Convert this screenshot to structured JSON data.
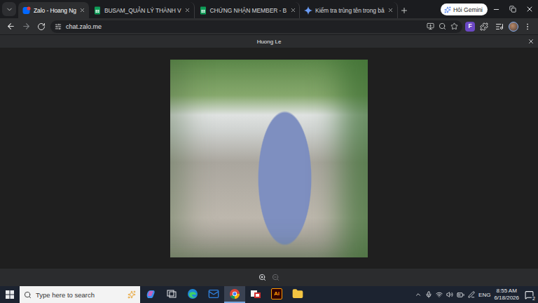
{
  "browser": {
    "tabs": [
      {
        "label": "Zalo - Hoang Ng",
        "selected": true,
        "kind": "zalo"
      },
      {
        "label": "BUSAM_QUẢN LÝ THÀNH V",
        "selected": false,
        "kind": "sheets"
      },
      {
        "label": "CHỨNG NHẬN MEMBER - B",
        "selected": false,
        "kind": "sheets"
      },
      {
        "label": "Kiểm tra trùng tên trong bả",
        "selected": false,
        "kind": "gemini"
      }
    ],
    "gemini_button": "Hỏi Gemini",
    "address": "chat.zalo.me",
    "extension_badge": "F"
  },
  "viewer": {
    "title": "Huong Le",
    "zoom_controls": [
      {
        "kind": "in",
        "disabled": false
      },
      {
        "kind": "out",
        "disabled": true
      }
    ]
  },
  "taskbar": {
    "search_placeholder": "Type here to search",
    "apps": [
      {
        "kind": "copilot",
        "active": false
      },
      {
        "kind": "task-view",
        "active": false
      },
      {
        "kind": "edge",
        "active": false
      },
      {
        "kind": "outlook",
        "active": false
      },
      {
        "kind": "chrome",
        "active": true
      },
      {
        "kind": "remote",
        "active": false
      },
      {
        "kind": "illustrator",
        "label": "Ai",
        "active": false
      },
      {
        "kind": "explorer",
        "active": false
      }
    ],
    "language": "ENG",
    "time": "8:55 AM",
    "date": "6/18/2026",
    "notifications": "2"
  }
}
